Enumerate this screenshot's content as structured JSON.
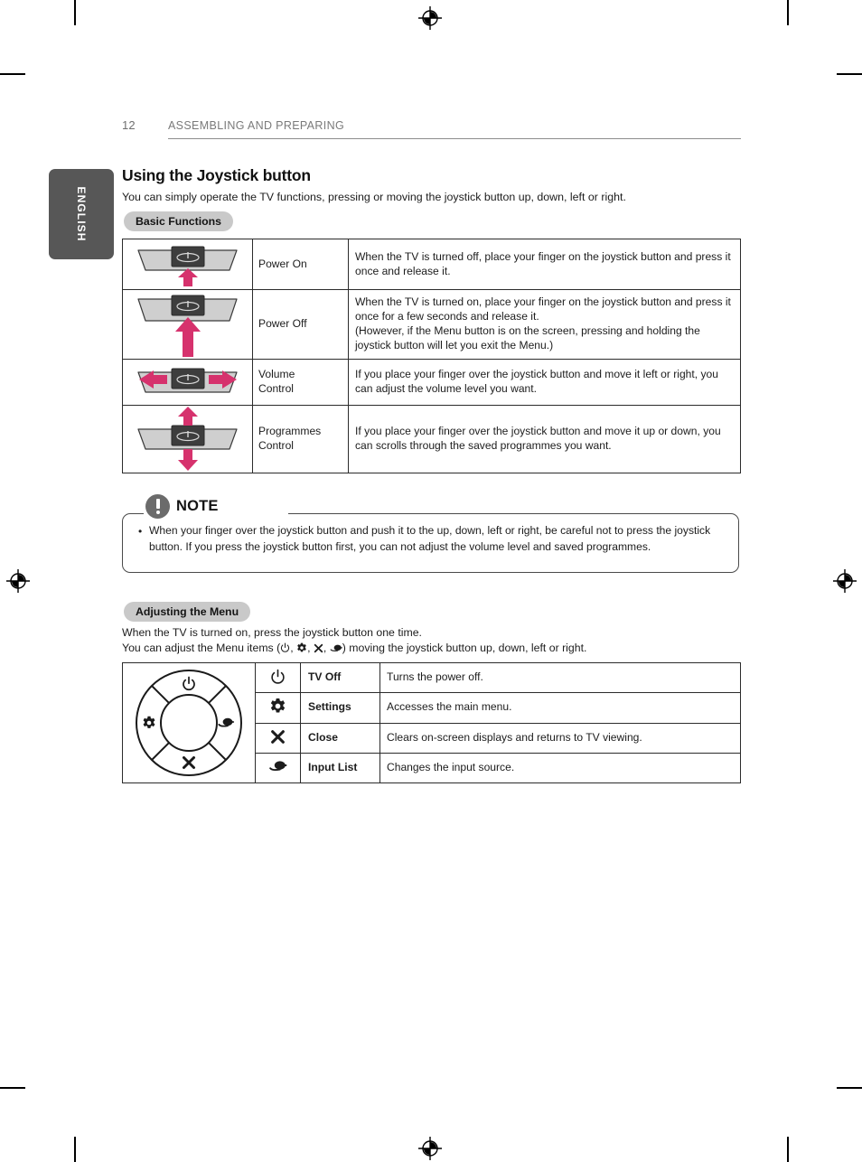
{
  "page": {
    "number": "12",
    "running_header": "ASSEMBLING AND PREPARING",
    "language_tab": "ENGLISH"
  },
  "section": {
    "title": "Using the Joystick button",
    "intro": "You can simply operate the TV functions, pressing or moving the joystick button up, down, left or right."
  },
  "basic_functions": {
    "pill_label": "Basic Functions",
    "rows": [
      {
        "illustration": "tv-joystick-press-up-small-arrow",
        "label": "Power On",
        "description": "When the TV is turned off, place your finger on the joystick button and press it once and release it."
      },
      {
        "illustration": "tv-joystick-press-up-large-arrow",
        "label": "Power Off",
        "description": "When the TV is turned on, place your finger on the joystick button and press it once for a few seconds and release it.\n(However, if the Menu button is on the screen, pressing and holding the joystick button will let you exit the Menu.)"
      },
      {
        "illustration": "tv-joystick-left-right-arrows",
        "label": "Volume\nControl",
        "description": "If you place your finger over the joystick button and move it left or right, you can adjust the volume level you want."
      },
      {
        "illustration": "tv-joystick-up-down-arrows",
        "label": "Programmes\nControl",
        "description": "If you place your finger over the joystick button and move it up or down, you can scrolls through the saved programmes you want."
      }
    ]
  },
  "note": {
    "title": "NOTE",
    "bullet": "•",
    "text": "When your finger over the joystick button and push it to the up, down, left or right, be careful not to press the joystick button. If you press the joystick button first, you can not adjust the volume level and saved programmes."
  },
  "adjusting_menu": {
    "pill_label": "Adjusting the Menu",
    "line1": "When the TV is turned on, press the joystick button one time.",
    "line2_prefix": "You can adjust the Menu items (",
    "line2_sep1": ", ",
    "line2_sep2": ", ",
    "line2_sep3": ", ",
    "line2_suffix": ") moving the joystick button up, down, left or right.",
    "wheel_icons": [
      "power-icon",
      "gear-icon",
      "close-x-icon",
      "input-list-icon"
    ],
    "rows": [
      {
        "icon": "power-icon",
        "name": "TV Off",
        "description": "Turns the power off."
      },
      {
        "icon": "gear-icon",
        "name": "Settings",
        "description": "Accesses the main menu."
      },
      {
        "icon": "close-x-icon",
        "name": "Close",
        "description": "Clears on-screen displays and returns to TV viewing."
      },
      {
        "icon": "input-list-icon",
        "name": "Input List",
        "description": "Changes the input source."
      }
    ]
  },
  "colors": {
    "arrow_pink": "#d6326d",
    "tab_gray": "#575757",
    "pill_gray": "#c9c9c9",
    "note_icon_gray": "#6b6b6b",
    "bezel_light": "#cfcfcf",
    "joystick_dark": "#3d3d3d"
  }
}
